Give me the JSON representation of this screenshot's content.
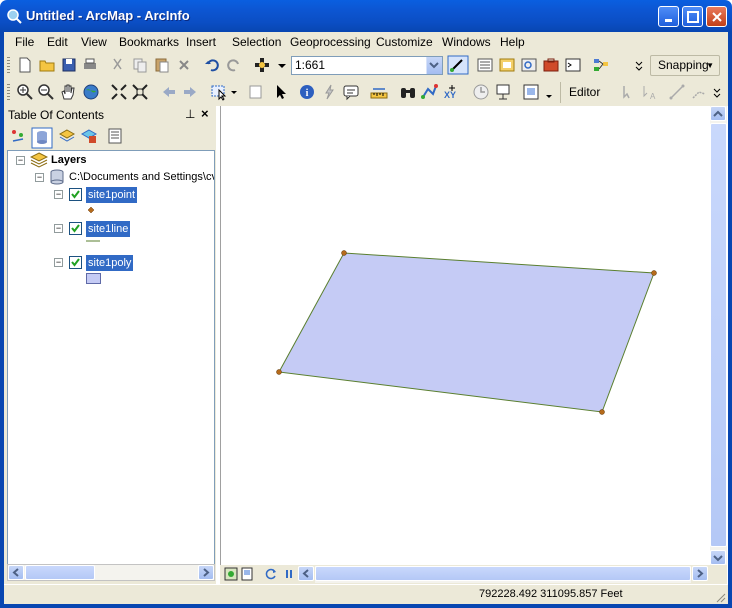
{
  "window": {
    "title": "Untitled - ArcMap - ArcInfo"
  },
  "menu": {
    "items": [
      "File",
      "Edit",
      "View",
      "Bookmarks",
      "Insert",
      "Selection",
      "Geoprocessing",
      "Customize",
      "Windows",
      "Help"
    ]
  },
  "toolbar": {
    "scale_value": "1:661",
    "snapping_label": "Snapping",
    "editor_label": "Editor"
  },
  "toc": {
    "title": "Table Of Contents",
    "root_label": "Layers",
    "workspace_label": "C:\\Documents and Settings\\cv",
    "layers": [
      {
        "name": "site1point",
        "checked": true,
        "symbol": "point"
      },
      {
        "name": "site1line",
        "checked": true,
        "symbol": "line"
      },
      {
        "name": "site1poly",
        "checked": true,
        "symbol": "polygon"
      }
    ]
  },
  "map": {
    "polygon_fill": "#c5cbf5",
    "polygon_stroke": "#5a7f2f",
    "vertex_color": "#b56a1b"
  },
  "status": {
    "coordinates": "792228.492  311095.857 Feet"
  },
  "colors": {
    "titlebar": "#0b4ec4",
    "chrome": "#ece9d8",
    "selection": "#316ac5"
  }
}
